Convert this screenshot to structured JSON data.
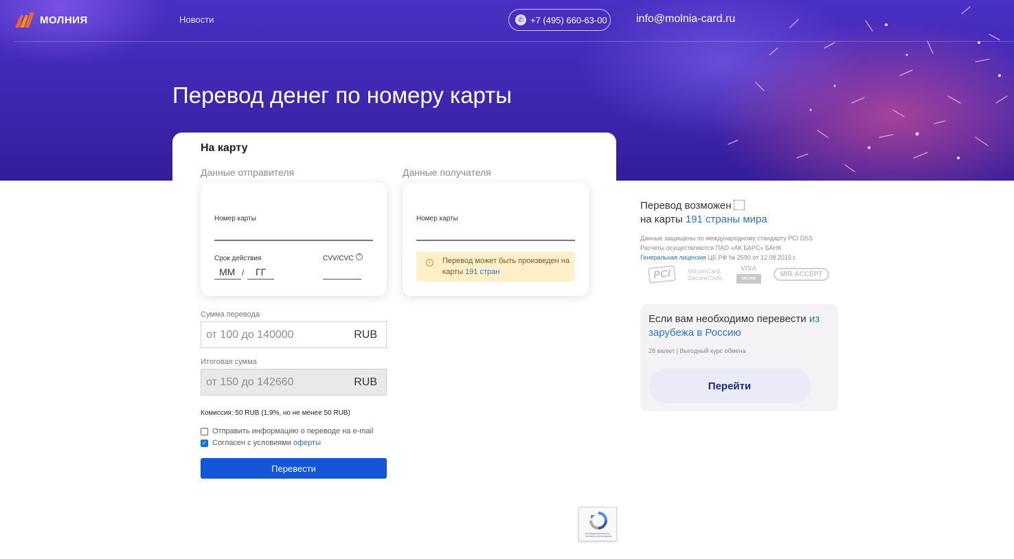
{
  "header": {
    "logo_text": "МОЛНИЯ",
    "nav_news": "Новости",
    "phone": "+7 (495) 660-63-00",
    "email": "info@molnia-card.ru"
  },
  "page_title": "Перевод денег по номеру карты",
  "form": {
    "heading": "На карту",
    "sender": {
      "section_label": "Данные отправителя",
      "card_number_label": "Номер карты",
      "expiry_label": "Срок действия",
      "month_placeholder": "ММ",
      "separator": "/",
      "year_placeholder": "ГГ",
      "cvv_label": "CVV/CVC",
      "cvv_help_icon": "?"
    },
    "recipient": {
      "section_label": "Данные получателя",
      "card_number_label": "Номер карты",
      "notice_text": "Перевод может быть произведен на карты",
      "notice_link": "191 стран"
    },
    "amount_label": "Сумма перевода",
    "amount_placeholder": "от 100 до 140000",
    "amount_currency": "RUB",
    "total_label": "Итоговая сумма",
    "total_placeholder": "от 150 до 142660",
    "total_currency": "RUB",
    "commission": "Комиссия: 50 RUB (1,9%, но не менее 50 RUB)",
    "email_checkbox_label": "Отправить информацию о переводе на e-mail",
    "email_checkbox_checked": false,
    "terms_checkbox_label": "Согласен с условиями",
    "terms_link": "оферты",
    "terms_checkbox_checked": true,
    "submit_label": "Перевести"
  },
  "side": {
    "title_line1": "Перевод возможен",
    "title_line2_prefix": "на карты ",
    "title_line2_link": "191 страны мира",
    "security_line1": "Данные защищены по международному стандарту PCI DSS",
    "security_line2": "Расчеты осуществляются ПАО «АК БАРС» БАНК",
    "license_link": "Генеральная лицензия",
    "license_rest": " ЦБ РФ № 2590 от 12.08.2015 г.",
    "badges": {
      "pci": "PCI",
      "mastercard_line1": "MasterCard.",
      "mastercard_line2": "SecureCode.",
      "visa": "VISA",
      "visa_bar": "SECURE",
      "mir": "MIR ACCEPT"
    },
    "abroad": {
      "title_prefix": "Если вам необходимо перевести ",
      "title_link": "из зарубежа в Россию",
      "subtitle": "28 валют | Выгодный курс обмена",
      "button": "Перейти"
    }
  },
  "recaptcha": {
    "text": "Конфиденциальность - Условия использования"
  },
  "colors": {
    "hero_purple": "#4a2fc4",
    "primary_button": "#1456d8",
    "link": "#2a73c9",
    "notice_bg": "#fdf0c8"
  }
}
